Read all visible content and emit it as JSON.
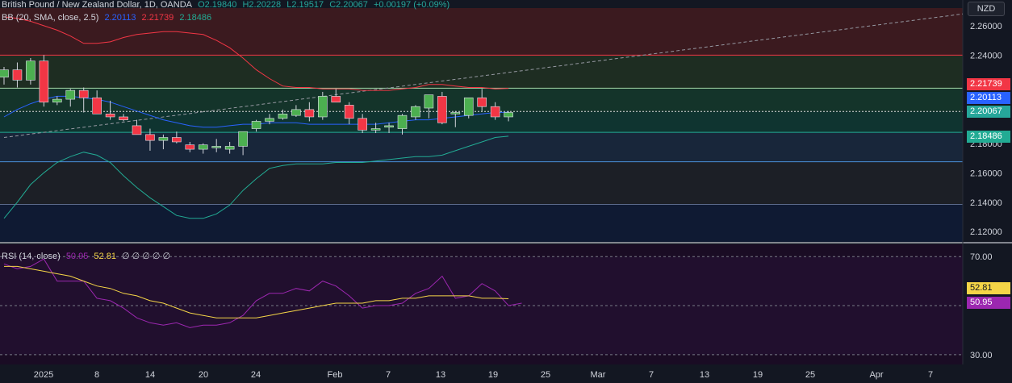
{
  "header": {
    "symbol": "British Pound / New Zealand Dollar, 1D, OANDA",
    "open": "O2.19840",
    "high": "H2.20228",
    "low": "L2.19517",
    "close": "C2.20067",
    "change": "+0.00197 (+0.09%)"
  },
  "bb_legend": {
    "label": "BB (20, SMA, close, 2.5)",
    "basis": "2.20113",
    "upper": "2.21739",
    "lower": "2.18486"
  },
  "rsi_legend": {
    "label": "RSI (14, close)",
    "rsi": "50.95",
    "sma": "52.81",
    "extra": "∅ ∅ ∅ ∅ ∅"
  },
  "currency_button": "NZD",
  "colors": {
    "up": "#26a69a",
    "down": "#f23645",
    "bb_basis": "#2962ff",
    "bb_upper": "#f23645",
    "bb_lower": "#22ab94",
    "rsi": "#9c27b0",
    "rsi_ma": "#f5d547"
  },
  "price_tags": {
    "upper": "2.21739",
    "basis": "2.20113",
    "close": "2.20067",
    "lower": "2.18486",
    "rsi_ma": "52.81",
    "rsi": "50.95"
  },
  "chart_data": [
    {
      "type": "candlestick",
      "title": "British Pound / New Zealand Dollar, 1D, OANDA",
      "yticks": [
        "2.26000",
        "2.24000",
        "2.22000",
        "2.20000",
        "2.18000",
        "2.16000",
        "2.14000",
        "2.12000"
      ],
      "ylim": [
        2.113,
        2.272
      ],
      "xticks": [
        "2025",
        "8",
        "14",
        "20",
        "24",
        "Feb",
        "7",
        "13",
        "19",
        "25",
        "Mar",
        "7",
        "13",
        "19",
        "25",
        "Apr",
        "7"
      ],
      "levels": [
        2.24,
        2.2175,
        2.2017,
        2.1875,
        2.1675,
        2.1385
      ],
      "candles": [
        {
          "o": 2.225,
          "h": 2.232,
          "l": 2.22,
          "c": 2.23
        },
        {
          "o": 2.23,
          "h": 2.235,
          "l": 2.218,
          "c": 2.223
        },
        {
          "o": 2.223,
          "h": 2.238,
          "l": 2.22,
          "c": 2.236
        },
        {
          "o": 2.236,
          "h": 2.24,
          "l": 2.205,
          "c": 2.208
        },
        {
          "o": 2.208,
          "h": 2.212,
          "l": 2.206,
          "c": 2.21
        },
        {
          "o": 2.21,
          "h": 2.217,
          "l": 2.205,
          "c": 2.216
        },
        {
          "o": 2.216,
          "h": 2.218,
          "l": 2.201,
          "c": 2.211
        },
        {
          "o": 2.211,
          "h": 2.216,
          "l": 2.2,
          "c": 2.2
        },
        {
          "o": 2.2,
          "h": 2.209,
          "l": 2.196,
          "c": 2.198
        },
        {
          "o": 2.198,
          "h": 2.2,
          "l": 2.195,
          "c": 2.196
        },
        {
          "o": 2.192,
          "h": 2.196,
          "l": 2.186,
          "c": 2.186
        },
        {
          "o": 2.186,
          "h": 2.19,
          "l": 2.175,
          "c": 2.182
        },
        {
          "o": 2.182,
          "h": 2.186,
          "l": 2.176,
          "c": 2.184
        },
        {
          "o": 2.184,
          "h": 2.188,
          "l": 2.18,
          "c": 2.181
        },
        {
          "o": 2.179,
          "h": 2.181,
          "l": 2.174,
          "c": 2.176
        },
        {
          "o": 2.176,
          "h": 2.18,
          "l": 2.173,
          "c": 2.179
        },
        {
          "o": 2.177,
          "h": 2.183,
          "l": 2.174,
          "c": 2.178
        },
        {
          "o": 2.176,
          "h": 2.181,
          "l": 2.173,
          "c": 2.178
        },
        {
          "o": 2.178,
          "h": 2.184,
          "l": 2.172,
          "c": 2.188
        },
        {
          "o": 2.19,
          "h": 2.196,
          "l": 2.188,
          "c": 2.195
        },
        {
          "o": 2.195,
          "h": 2.2,
          "l": 2.193,
          "c": 2.197
        },
        {
          "o": 2.197,
          "h": 2.203,
          "l": 2.196,
          "c": 2.2
        },
        {
          "o": 2.199,
          "h": 2.206,
          "l": 2.198,
          "c": 2.203
        },
        {
          "o": 2.203,
          "h": 2.208,
          "l": 2.195,
          "c": 2.198
        },
        {
          "o": 2.198,
          "h": 2.215,
          "l": 2.196,
          "c": 2.212
        },
        {
          "o": 2.212,
          "h": 2.217,
          "l": 2.208,
          "c": 2.208
        },
        {
          "o": 2.206,
          "h": 2.208,
          "l": 2.193,
          "c": 2.197
        },
        {
          "o": 2.197,
          "h": 2.2,
          "l": 2.187,
          "c": 2.189
        },
        {
          "o": 2.189,
          "h": 2.194,
          "l": 2.187,
          "c": 2.19
        },
        {
          "o": 2.191,
          "h": 2.194,
          "l": 2.187,
          "c": 2.192
        },
        {
          "o": 2.19,
          "h": 2.2,
          "l": 2.186,
          "c": 2.199
        },
        {
          "o": 2.198,
          "h": 2.206,
          "l": 2.196,
          "c": 2.205
        },
        {
          "o": 2.204,
          "h": 2.213,
          "l": 2.197,
          "c": 2.213
        },
        {
          "o": 2.212,
          "h": 2.215,
          "l": 2.193,
          "c": 2.194
        },
        {
          "o": 2.2,
          "h": 2.202,
          "l": 2.191,
          "c": 2.201
        },
        {
          "o": 2.199,
          "h": 2.21,
          "l": 2.197,
          "c": 2.211
        },
        {
          "o": 2.211,
          "h": 2.217,
          "l": 2.202,
          "c": 2.205
        },
        {
          "o": 2.205,
          "h": 2.208,
          "l": 2.196,
          "c": 2.198
        },
        {
          "o": 2.198,
          "h": 2.202,
          "l": 2.195,
          "c": 2.201
        }
      ],
      "bb_upper": [
        2.266,
        2.265,
        2.263,
        2.26,
        2.257,
        2.253,
        2.248,
        2.248,
        2.249,
        2.252,
        2.254,
        2.255,
        2.256,
        2.256,
        2.255,
        2.254,
        2.25,
        2.245,
        2.238,
        2.23,
        2.224,
        2.219,
        2.218,
        2.218,
        2.217,
        2.217,
        2.217,
        2.216,
        2.216,
        2.216,
        2.217,
        2.218,
        2.22,
        2.22,
        2.219,
        2.218,
        2.218,
        2.217,
        2.2174
      ],
      "bb_basis": [
        2.198,
        2.203,
        2.207,
        2.21,
        2.212,
        2.212,
        2.211,
        2.21,
        2.208,
        2.205,
        2.202,
        2.199,
        2.196,
        2.194,
        2.192,
        2.191,
        2.191,
        2.192,
        2.193,
        2.193,
        2.194,
        2.194,
        2.194,
        2.193,
        2.193,
        2.193,
        2.193,
        2.193,
        2.193,
        2.194,
        2.195,
        2.196,
        2.196,
        2.197,
        2.198,
        2.199,
        2.2,
        2.201,
        2.2011
      ],
      "bb_lower": [
        2.129,
        2.14,
        2.152,
        2.16,
        2.167,
        2.171,
        2.174,
        2.172,
        2.167,
        2.158,
        2.15,
        2.143,
        2.137,
        2.131,
        2.129,
        2.129,
        2.132,
        2.138,
        2.148,
        2.156,
        2.163,
        2.165,
        2.166,
        2.166,
        2.166,
        2.167,
        2.167,
        2.167,
        2.168,
        2.169,
        2.17,
        2.171,
        2.171,
        2.172,
        2.175,
        2.178,
        2.181,
        2.184,
        2.1849
      ],
      "trendline": {
        "from": {
          "bar": 0,
          "value": 2.184
        },
        "to_value_at_edge": 2.268
      },
      "rsi": {
        "yticks": [
          "70.00",
          "30.00"
        ],
        "ylim": [
          26,
          75
        ],
        "levels": [
          70,
          50,
          30
        ],
        "values": [
          67,
          65,
          66,
          69,
          60,
          60,
          60,
          53,
          52,
          49,
          45,
          43,
          42,
          43,
          41,
          42,
          42,
          43,
          46,
          52,
          55,
          55,
          57,
          56,
          60,
          58,
          54,
          49,
          50,
          50,
          51,
          55,
          57,
          62,
          53,
          54,
          59,
          56,
          50,
          51
        ],
        "ma": [
          66,
          66,
          65,
          64,
          63,
          62,
          60,
          58,
          57,
          55,
          54,
          52,
          51,
          49,
          47,
          46,
          45,
          45,
          45,
          45,
          46,
          47,
          48,
          49,
          50,
          51,
          51,
          51,
          52,
          52,
          53,
          53,
          54,
          54,
          54,
          54,
          53,
          53,
          52.8
        ]
      }
    }
  ]
}
